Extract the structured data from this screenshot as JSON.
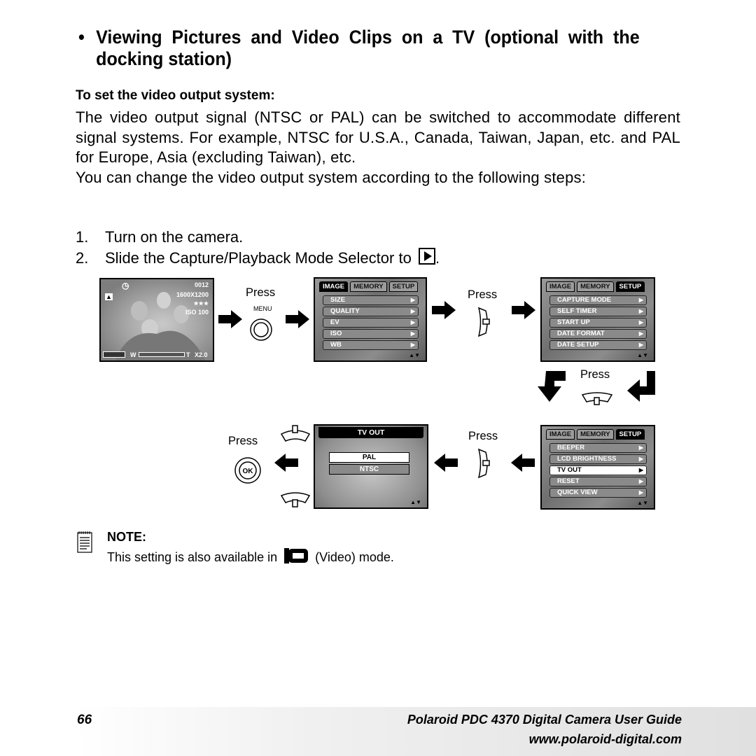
{
  "heading": {
    "bullet": "•",
    "text": "Viewing Pictures and Video Clips on a TV (optional with the docking station)"
  },
  "subheading": "To set the video output system:",
  "paragraphs": [
    "The video output signal (NTSC or PAL) can be switched to accommodate different signal systems. For example, NTSC for U.S.A., Canada, Taiwan, Japan, etc. and PAL for Europe, Asia (excluding Taiwan), etc.",
    "You can change the video output system according to the following steps:"
  ],
  "steps": [
    {
      "num": "1.",
      "text": "Turn on the camera."
    },
    {
      "num": "2.",
      "text": "Slide the Capture/Playback Mode Selector to",
      "icon": "playback-mode-icon",
      "suffix": "."
    }
  ],
  "diagram": {
    "photo_screen": {
      "frame_count": "0012",
      "resolution": "1600X1200",
      "quality": "★★★",
      "iso": "ISO 100",
      "zoom_w": "W",
      "zoom_t": "T",
      "zoom_value": "X2.0"
    },
    "press_labels": [
      "Press",
      "Press",
      "Press",
      "Press",
      "Press"
    ],
    "menu_button_label": "MENU",
    "ok_button_label": "OK",
    "tabs": [
      "IMAGE",
      "MEMORY",
      "SETUP"
    ],
    "image_menu": [
      "SIZE",
      "QUALITY",
      "EV",
      "ISO",
      "WB"
    ],
    "setup_menu_page1": [
      "CAPTURE MODE",
      "SELF TIMER",
      "START UP",
      "DATE FORMAT",
      "DATE SETUP"
    ],
    "setup_menu_page2": [
      "BEEPER",
      "LCD BRIGHTNESS",
      "TV OUT",
      "RESET",
      "QUICK VIEW"
    ],
    "setup_menu_page2_selected": "TV OUT",
    "tvout": {
      "title": "TV OUT",
      "options": [
        "PAL",
        "NTSC"
      ],
      "selected": "PAL"
    },
    "arrow_glyph": "▶",
    "scroll_glyph": "▲▼"
  },
  "note": {
    "title": "NOTE:",
    "text_before": "This setting is also available in",
    "text_after": "(Video) mode."
  },
  "footer": {
    "page_number": "66",
    "guide_title": "Polaroid PDC 4370 Digital Camera User Guide",
    "url": "www.polaroid-digital.com"
  }
}
